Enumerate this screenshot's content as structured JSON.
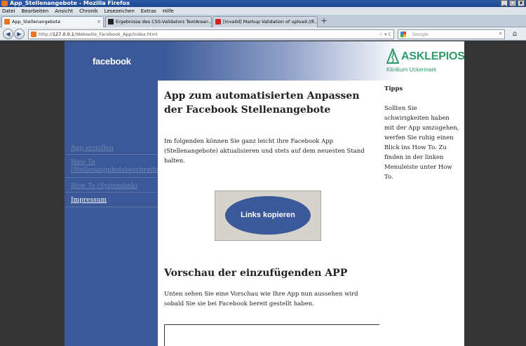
{
  "window": {
    "title": "App_Stellenangebote - Mozilla Firefox",
    "controls": [
      "_",
      "▢",
      "x"
    ]
  },
  "menu": [
    "Datei",
    "Bearbeiten",
    "Ansicht",
    "Chronik",
    "Lesezeichen",
    "Extras",
    "Hilfe"
  ],
  "tabs": [
    {
      "label": "App_Stellenangebote",
      "active": true,
      "icon_color": "#e8742a"
    },
    {
      "label": "Ergebnisse des CSS-Validators TextArea ...",
      "active": false,
      "icon_color": "#222222"
    },
    {
      "label": "[Invalid] Markup Validation of upload://F...",
      "active": false,
      "icon_color": "#cc2222"
    }
  ],
  "tab_close_glyph": "×",
  "newtab_glyph": "+",
  "address": {
    "prefix": "http://",
    "host": "127.0.0.1",
    "path": "/Webseite_Facebook_App/index.html"
  },
  "search": {
    "placeholder": "Google"
  },
  "page": {
    "header": {
      "fb_logo": "facebook",
      "asklepios_name": "ASKLEPIOS",
      "asklepios_sub": "Klinikum Uckermark"
    },
    "nav": [
      {
        "label": "App erstellen"
      },
      {
        "label": "How To (Stellenangebotsbeschreibung)"
      },
      {
        "label": "How To (Systemlink)"
      },
      {
        "label": "Impressum"
      }
    ],
    "main": {
      "heading": "App zum automatisierten Anpassen der Facebook Stellenangebote",
      "intro": "Im folgenden können Sie ganz leicht ihre Facebook App (Stellenangebote) aktualisieren und stets auf dem neuesten Stand halten.",
      "copy_button": "Links kopieren",
      "preview_heading": "Vorschau der einzufügenden APP",
      "preview_text": "Unten sehen Sie eine Vorschau wie Ihre App nun aussehen wird sobald Sie sie bei Facebook bereit gestellt haben."
    },
    "tips": {
      "title": "Tipps",
      "text": "Sollten Sie schwirigkeiten haben mit der App umzugehen, werfen Sie ruhig einen Blick ins How To. Zu finden in der linken Menuleiste unter How To."
    }
  },
  "colors": {
    "facebook_blue": "#3b5998",
    "asklepios_green": "#2f9a6a",
    "inactive_link": "#6f86b8"
  }
}
